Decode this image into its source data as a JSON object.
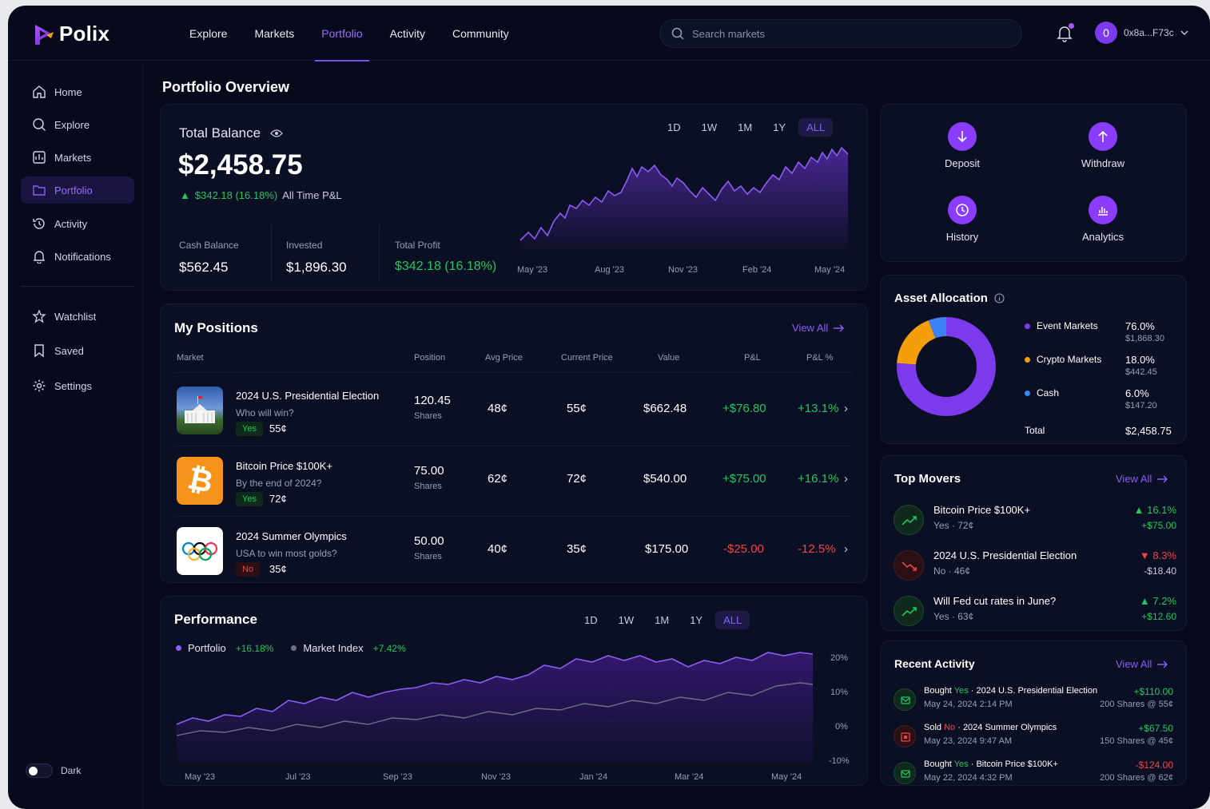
{
  "app": {
    "name": "Polix"
  },
  "nav": {
    "items": [
      "Explore",
      "Markets",
      "Portfolio",
      "Activity",
      "Community"
    ],
    "active": "Portfolio"
  },
  "search": {
    "placeholder": "Search markets"
  },
  "user": {
    "avatar_letter": "0",
    "address": "0x8a...F73c"
  },
  "sidebar": {
    "items": [
      {
        "label": "Home",
        "icon": "home-icon"
      },
      {
        "label": "Explore",
        "icon": "search-icon"
      },
      {
        "label": "Markets",
        "icon": "chart-icon"
      },
      {
        "label": "Portfolio",
        "icon": "folder-icon"
      },
      {
        "label": "Activity",
        "icon": "history-icon"
      },
      {
        "label": "Notifications",
        "icon": "bell-icon"
      },
      {
        "label": "Watchlist",
        "icon": "star-icon"
      },
      {
        "label": "Saved",
        "icon": "bookmark-icon"
      },
      {
        "label": "Settings",
        "icon": "gear-icon"
      }
    ],
    "active": "Portfolio",
    "theme_label": "Dark"
  },
  "page_title": "Portfolio Overview",
  "balance": {
    "label": "Total Balance",
    "amount": "$2,458.75",
    "change": "$342.18 (16.18%)",
    "change_label": "All Time P&L",
    "timeframes": [
      "1D",
      "1W",
      "1M",
      "1Y",
      "ALL"
    ],
    "active_timeframe": "ALL",
    "stats": [
      {
        "label": "Cash Balance",
        "value": "$562.45"
      },
      {
        "label": "Invested",
        "value": "$1,896.30"
      },
      {
        "label": "Total Profit",
        "value": "$342.18 (16.18%)"
      }
    ],
    "x_labels": [
      "May '23",
      "Aug '23",
      "Nov '23",
      "Feb '24",
      "May '24"
    ]
  },
  "quick_actions": [
    {
      "label": "Deposit",
      "icon": "arrow-down-icon"
    },
    {
      "label": "Withdraw",
      "icon": "arrow-up-icon"
    },
    {
      "label": "History",
      "icon": "clock-icon"
    },
    {
      "label": "Analytics",
      "icon": "bar-chart-icon"
    }
  ],
  "positions": {
    "title": "My Positions",
    "view_all": "View All",
    "headers": [
      "Market",
      "Position",
      "Avg Price",
      "Current Price",
      "Value",
      "P&L",
      "P&L %"
    ],
    "rows": [
      {
        "title": "2024 U.S. Presidential Election",
        "subtitle": "Who will win?",
        "outcome": "Yes",
        "price": "55¢",
        "position": "120.45",
        "unit": "Shares",
        "avg": "48¢",
        "current": "55¢",
        "value": "$662.48",
        "pnl": "+$76.80",
        "pnl_pct": "+13.1%",
        "thumb": "white-house-image"
      },
      {
        "title": "Bitcoin Price $100K+",
        "subtitle": "By the end of 2024?",
        "outcome": "Yes",
        "price": "72¢",
        "position": "75.00",
        "unit": "Shares",
        "avg": "62¢",
        "current": "72¢",
        "value": "$540.00",
        "pnl": "+$75.00",
        "pnl_pct": "+16.1%",
        "thumb": "bitcoin-logo"
      },
      {
        "title": "2024 Summer Olympics",
        "subtitle": "USA to win most golds?",
        "outcome": "No",
        "price": "35¢",
        "position": "50.00",
        "unit": "Shares",
        "avg": "40¢",
        "current": "35¢",
        "value": "$175.00",
        "pnl": "-$25.00",
        "pnl_pct": "-12.5%",
        "thumb": "olympic-rings-logo"
      }
    ]
  },
  "performance": {
    "title": "Performance",
    "timeframes": [
      "1D",
      "1W",
      "1M",
      "1Y",
      "ALL"
    ],
    "active_timeframe": "ALL",
    "legend": [
      {
        "name": "Portfolio",
        "change": "+16.18%",
        "color": "#8b5cf6"
      },
      {
        "name": "Market Index",
        "change": "+7.42%",
        "color": "#6b7280"
      }
    ],
    "y_labels": [
      "20%",
      "10%",
      "0%",
      "-10%"
    ],
    "x_labels": [
      "May '23",
      "Jul '23",
      "Sep '23",
      "Nov '23",
      "Jan '24",
      "Mar '24",
      "May '24"
    ]
  },
  "allocation": {
    "title": "Asset Allocation",
    "items": [
      {
        "name": "Event Markets",
        "pct": "76.0%",
        "amount": "$1,868.30",
        "color": "#7c3aed"
      },
      {
        "name": "Crypto Markets",
        "pct": "18.0%",
        "amount": "$442.45",
        "color": "#f59e0b"
      },
      {
        "name": "Cash",
        "pct": "6.0%",
        "amount": "$147.20",
        "color": "#3b82f6"
      }
    ],
    "total_label": "Total",
    "total": "$2,458.75"
  },
  "top_movers": {
    "title": "Top Movers",
    "view_all": "View All",
    "items": [
      {
        "title": "Bitcoin Price $100K+",
        "sub": "Yes · 72¢",
        "pct": "16.1%",
        "amount": "+$75.00",
        "dir": "up"
      },
      {
        "title": "2024 U.S. Presidential Election",
        "sub": "No · 46¢",
        "pct": "8.3%",
        "amount": "-$18.40",
        "dir": "down"
      },
      {
        "title": "Will Fed cut rates in June?",
        "sub": "Yes · 63¢",
        "pct": "7.2%",
        "amount": "+$12.60",
        "dir": "up"
      }
    ]
  },
  "recent_activity": {
    "title": "Recent Activity",
    "view_all": "View All",
    "items": [
      {
        "action": "Bought",
        "side": "Yes",
        "market": "2024 U.S. Presidential Election",
        "date": "May 24, 2024 2:14 PM",
        "amount": "+$110.00",
        "shares": "200 Shares @ 55¢",
        "type": "buy"
      },
      {
        "action": "Sold",
        "side": "No",
        "market": "2024 Summer Olympics",
        "date": "May 23, 2024 9:47 AM",
        "amount": "+$67.50",
        "shares": "150 Shares @ 45¢",
        "type": "sell"
      },
      {
        "action": "Bought",
        "side": "Yes",
        "market": "Bitcoin Price $100K+",
        "date": "May 22, 2024 4:32 PM",
        "amount": "-$124.00",
        "shares": "200 Shares @ 62¢",
        "type": "buy"
      }
    ]
  },
  "colors": {
    "accent": "#8b5cf6",
    "positive": "#22c55e",
    "negative": "#ef4444",
    "background": "#070a1b"
  }
}
